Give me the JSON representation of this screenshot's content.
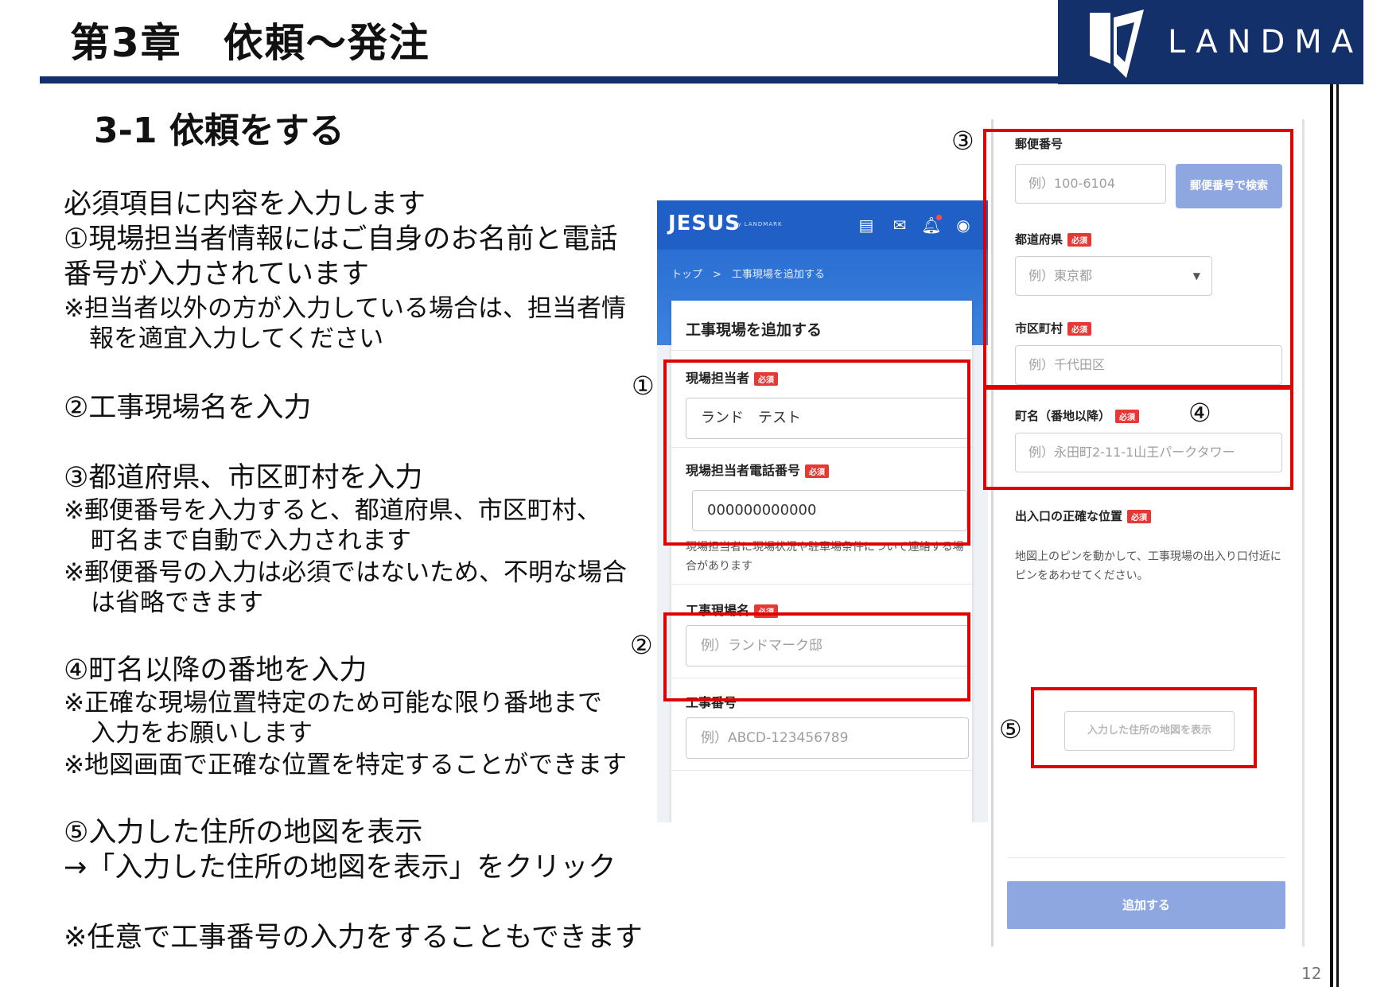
{
  "header": {
    "chapter_title": "第3章　依頼～発注",
    "logo_text": "LANDMARK",
    "colors": {
      "navy": "#14306a",
      "highlight_red": "#e00000",
      "app_blue": "#1f5fc6"
    }
  },
  "section_title": "3-1 依頼をする",
  "instructions": {
    "l1": "必須項目に内容を入力します",
    "l2": "①現場担当者情報にはご自身のお名前と電話",
    "l3": "番号が入力されています",
    "l4": "※担当者以外の方が入力している場合は、担当者情",
    "l5": "報を適宜入力してください",
    "l6": "②工事現場名を入力",
    "l7": "③都道府県、市区町村を入力",
    "l8": "※郵便番号を入力すると、都道府県、市区町村、",
    "l9": "町名まで自動で入力されます",
    "l10": "※郵便番号の入力は必須ではないため、不明な場合",
    "l11": "は省略できます",
    "l12": "④町名以降の番地を入力",
    "l13": "※正確な現場位置特定のため可能な限り番地まで",
    "l14": "入力をお願いします",
    "l15": "※地図画面で正確な位置を特定することができます",
    "l16": "⑤入力した住所の地図を表示",
    "l17": "→「入力した住所の地図を表示」をクリック",
    "l18": "※任意で工事番号の入力をすることもできます"
  },
  "markers": {
    "m1": "①",
    "m2": "②",
    "m3": "③",
    "m4": "④",
    "m5": "⑤"
  },
  "app": {
    "logo": "JESUS",
    "logo_sub": "by LANDMARK",
    "icons": [
      "list-icon",
      "mail-icon",
      "bell-icon",
      "account-icon"
    ],
    "breadcrumb": "トップ　>　工事現場を追加する",
    "card_title": "工事現場を追加する",
    "required_badge": "必須",
    "site_manager_label": "現場担当者",
    "site_manager_value": "ランド　テスト",
    "site_phone_label": "現場担当者電話番号",
    "site_phone_value": "000000000000",
    "site_note": "現場担当者に現場状況や駐車場条件について連絡する場合があります",
    "site_name_label": "工事現場名",
    "site_name_placeholder": "例）ランドマーク邸",
    "job_number_label": "工事番号",
    "job_number_placeholder": "例）ABCD-123456789"
  },
  "address": {
    "postal_label": "郵便番号",
    "postal_placeholder": "例）100-6104",
    "postal_search_button": "郵便番号で検索",
    "prefecture_label": "都道府県",
    "prefecture_placeholder": "例）東京都",
    "city_label": "市区町村",
    "city_placeholder": "例）千代田区",
    "town_label": "町名（番地以降）",
    "town_placeholder": "例）永田町2-11-1山王パークタワー",
    "entrance_label": "出入口の正確な位置",
    "entrance_note": "地図上のピンを動かして、工事現場の出入り口付近にピンをあわせてください。",
    "map_button": "入力した住所の地図を表示",
    "add_button": "追加する"
  },
  "page_number": "12"
}
